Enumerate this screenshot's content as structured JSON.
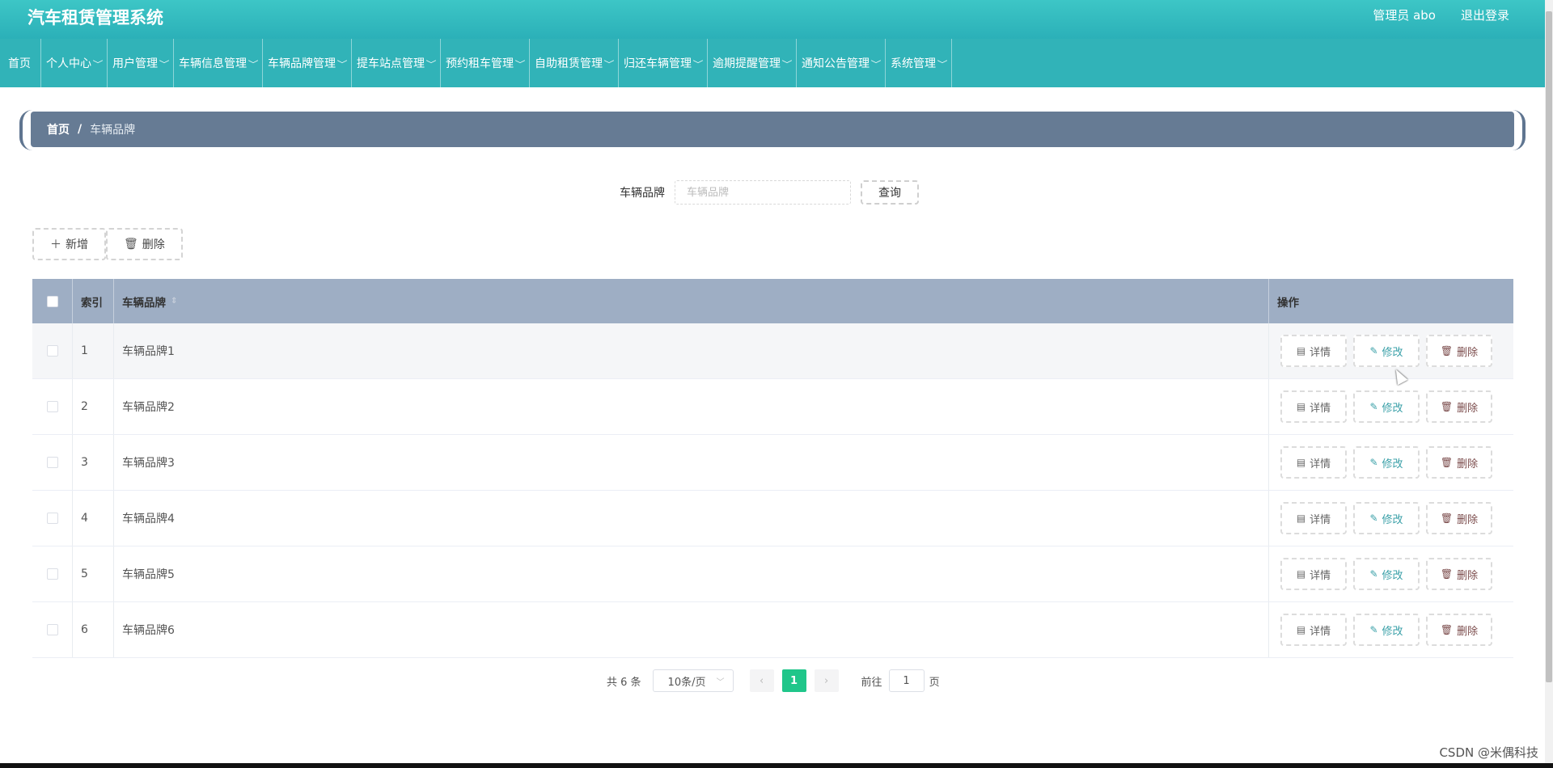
{
  "header": {
    "title": "汽车租赁管理系统",
    "user": "管理员 abo",
    "logout": "退出登录"
  },
  "nav": {
    "items": [
      {
        "label": "首页",
        "has_dropdown": false
      },
      {
        "label": "个人中心",
        "has_dropdown": true
      },
      {
        "label": "用户管理",
        "has_dropdown": true
      },
      {
        "label": "车辆信息管理",
        "has_dropdown": true
      },
      {
        "label": "车辆品牌管理",
        "has_dropdown": true
      },
      {
        "label": "提车站点管理",
        "has_dropdown": true
      },
      {
        "label": "预约租车管理",
        "has_dropdown": true
      },
      {
        "label": "自助租赁管理",
        "has_dropdown": true
      },
      {
        "label": "归还车辆管理",
        "has_dropdown": true
      },
      {
        "label": "逾期提醒管理",
        "has_dropdown": true
      },
      {
        "label": "通知公告管理",
        "has_dropdown": true
      },
      {
        "label": "系统管理",
        "has_dropdown": true
      }
    ]
  },
  "breadcrumb": {
    "home": "首页",
    "separator": "/",
    "current": "车辆品牌"
  },
  "search": {
    "label": "车辆品牌",
    "placeholder": "车辆品牌",
    "value": "",
    "button": "查询"
  },
  "actions": {
    "add": "新增",
    "delete": "删除"
  },
  "table": {
    "headers": {
      "index": "索引",
      "name": "车辆品牌",
      "ops": "操作"
    },
    "op_labels": {
      "detail": "详情",
      "edit": "修改",
      "delete": "删除"
    },
    "rows": [
      {
        "index": "1",
        "name": "车辆品牌1"
      },
      {
        "index": "2",
        "name": "车辆品牌2"
      },
      {
        "index": "3",
        "name": "车辆品牌3"
      },
      {
        "index": "4",
        "name": "车辆品牌4"
      },
      {
        "index": "5",
        "name": "车辆品牌5"
      },
      {
        "index": "6",
        "name": "车辆品牌6"
      }
    ],
    "hovered_row": 0
  },
  "pagination": {
    "total": "共 6 条",
    "page_size": "10条/页",
    "current": "1",
    "goto_label": "前往",
    "goto_value": "1",
    "page_suffix": "页"
  },
  "watermark": "CSDN @米偶科技",
  "colors": {
    "header": "#31b3b8",
    "breadcrumb": "#667b94",
    "table_header": "#9eaec4",
    "active_page": "#20c68a"
  }
}
